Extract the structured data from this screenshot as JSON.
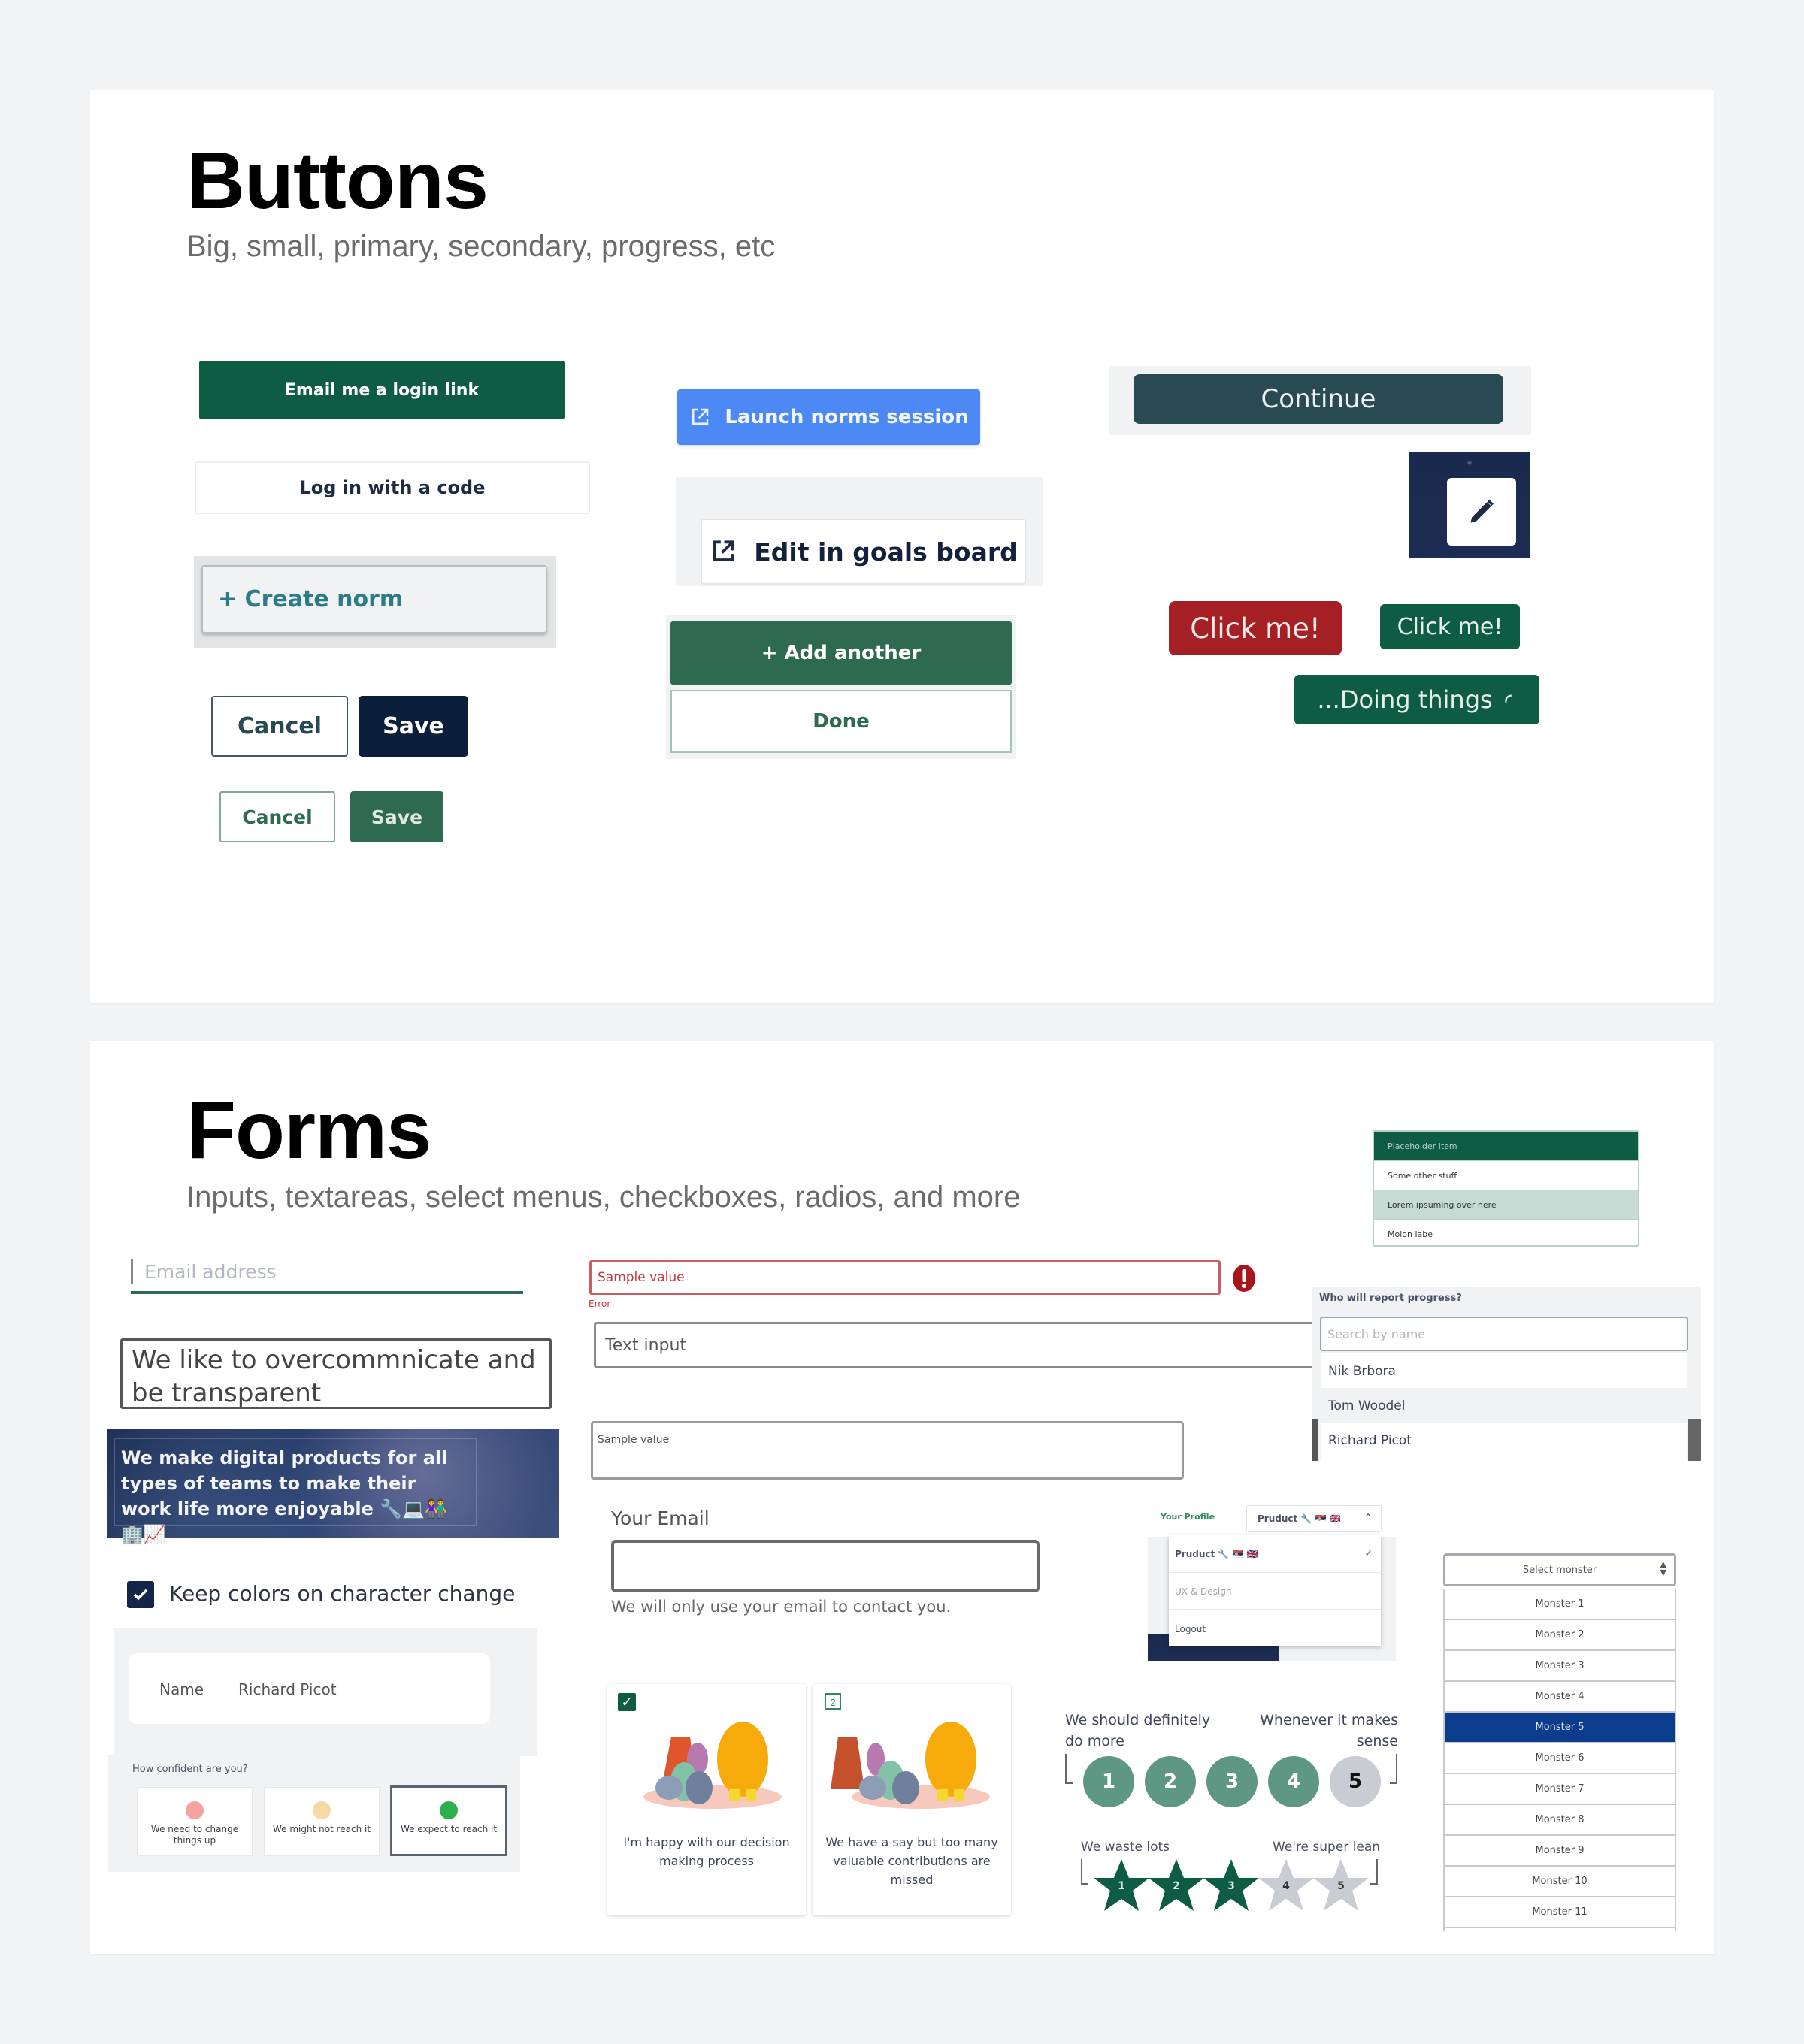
{
  "buttons_section": {
    "title": "Buttons",
    "subtitle": "Big, small, primary, secondary, progress, etc",
    "email_login": "Email me a login link",
    "log_in_code": "Log in with a code",
    "create_norm": "+ Create norm",
    "cancel_dark": "Cancel",
    "save_dark": "Save",
    "cancel_green": "Cancel",
    "save_green": "Save",
    "launch_norms": "Launch norms session",
    "edit_goals": "Edit in goals board",
    "add_another": "+ Add another",
    "done": "Done",
    "continue": "Continue",
    "click_me_red": "Click me!",
    "click_me_green": "Click me!",
    "doing_things": "...Doing things",
    "icons": {
      "external_link": "external-link-icon",
      "pencil": "pencil-icon",
      "spinner": "spinner-icon"
    }
  },
  "forms_section": {
    "title": "Forms",
    "subtitle": "Inputs, textareas, select menus, checkboxes, radios, and more",
    "email_placeholder": "Email address",
    "textarea_value": "We like to overcommnicate and be transparent",
    "mission_text": "We make digital products for all types of teams to make their work life more enjoyable 🔧💻👫🏢📈",
    "error_input_value": "Sample value",
    "error_label": "Error",
    "text_input_placeholder": "Text input",
    "sample_textarea_value": "Sample value",
    "your_email_label": "Your Email",
    "your_email_value": "",
    "your_email_help": "We will only use your email to contact you.",
    "checkbox_label": "Keep colors on character change",
    "checkbox_checked": true,
    "name_label": "Name",
    "name_value": "Richard Picot",
    "confidence": {
      "question": "How confident are you?",
      "options": [
        {
          "label": "We need to change things up",
          "color": "#f4a3a0"
        },
        {
          "label": "We might not reach it",
          "color": "#f6d9a4"
        },
        {
          "label": "We expect to reach it",
          "color": "#2bb04a"
        }
      ],
      "selected_index": 2
    },
    "list_menu": {
      "items": [
        "Placeholder item",
        "Some other stuff",
        "Lorem ipsuming over here",
        "Molon labe"
      ],
      "active_index": 0,
      "highlight_index": 2
    },
    "reporter": {
      "label": "Who will report progress?",
      "search_placeholder": "Search by name",
      "options": [
        "Nik Brbora",
        "Tom Woodel",
        "Richard Picot"
      ],
      "hover_index": 1
    },
    "profile": {
      "label": "Your Profile",
      "selected": "Pruduct 🔧 🇷🇸 🇬🇧",
      "options": [
        "Pruduct 🔧 🇷🇸 🇬🇧",
        "UX & Design",
        "Logout"
      ],
      "checked_index": 0
    },
    "cards": [
      {
        "text": "I'm happy with our decision making process",
        "badge": "✓",
        "checked": true
      },
      {
        "text": "We have a say but too many valuable contributions are missed",
        "badge": "2",
        "checked": false
      }
    ],
    "circle_scale": {
      "left_label": "We should definitely do more",
      "right_label": "Whenever it makes sense",
      "values": [
        "1",
        "2",
        "3",
        "4",
        "5"
      ],
      "selected_value": 4
    },
    "star_scale": {
      "left_label": "We waste lots",
      "right_label": "We're super lean",
      "values": [
        "1",
        "2",
        "3",
        "4",
        "5"
      ],
      "selected_value": 3
    },
    "monster_select": {
      "placeholder": "Select monster",
      "options": [
        "Monster 1",
        "Monster 2",
        "Monster 3",
        "Monster 4",
        "Monster 5",
        "Monster 6",
        "Monster 7",
        "Monster 8",
        "Monster 9",
        "Monster 10",
        "Monster 11"
      ],
      "selected_index": 4
    }
  },
  "colors": {
    "brand_green": "#0f5c45",
    "mid_green": "#2e6a4f",
    "navy": "#0b1f3a",
    "teal_dark": "#294a53",
    "blue": "#4d89f5",
    "red": "#a52024",
    "select_blue": "#0c3d8c",
    "circle_green": "#5e9784",
    "muted_grey": "#c9ccd3"
  }
}
